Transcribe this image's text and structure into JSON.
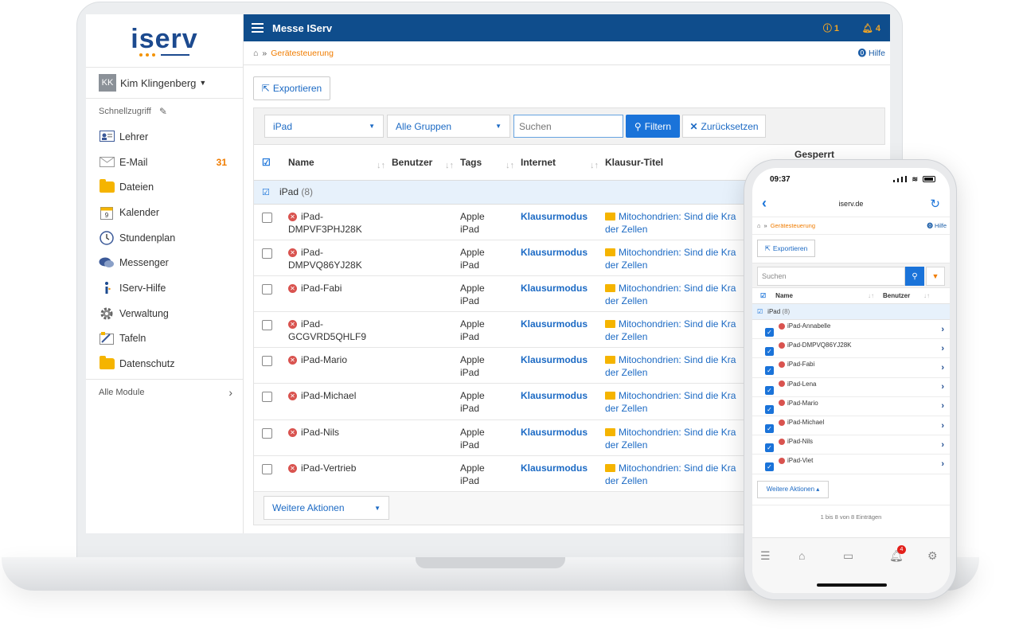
{
  "app": {
    "title": "Messe IServ",
    "logo_text": "iserv",
    "info_count": "1",
    "notif_count": "4"
  },
  "user": {
    "initials": "KK",
    "name": "Kim Klingenberg"
  },
  "sidebar": {
    "quick_label": "Schnellzugriff",
    "items": [
      {
        "label": "Lehrer",
        "icon": "teacher-icon"
      },
      {
        "label": "E-Mail",
        "icon": "mail-icon",
        "badge": "31"
      },
      {
        "label": "Dateien",
        "icon": "folder-icon"
      },
      {
        "label": "Kalender",
        "icon": "calendar-icon"
      },
      {
        "label": "Stundenplan",
        "icon": "clock-icon"
      },
      {
        "label": "Messenger",
        "icon": "chat-icon"
      },
      {
        "label": "IServ-Hilfe",
        "icon": "info-icon"
      },
      {
        "label": "Verwaltung",
        "icon": "gear-icon"
      },
      {
        "label": "Tafeln",
        "icon": "board-icon"
      },
      {
        "label": "Datenschutz",
        "icon": "folder-icon"
      }
    ],
    "all_modules": "Alle Module"
  },
  "breadcrumb": {
    "current": "Gerätesteuerung",
    "help": "Hilfe"
  },
  "toolbar": {
    "export_label": "Exportieren"
  },
  "filters": {
    "device_select": "iPad",
    "group_select": "Alle Gruppen",
    "search_placeholder": "Suchen",
    "filter_label": "Filtern",
    "reset_label": "Zurücksetzen"
  },
  "table": {
    "columns": [
      "Name",
      "Benutzer",
      "Tags",
      "Internet",
      "Klausur-Titel",
      "Gesperrt"
    ],
    "group": {
      "name": "iPad",
      "count": "(8)"
    },
    "rows": [
      {
        "name": "iPad-\nDMPVF3PHJ28K",
        "tags": "Apple\niPad",
        "internet": "Klausurmodus",
        "title": "Mitochondrien: Sind die Kra\nder Zellen"
      },
      {
        "name": "iPad-\nDMPVQ86YJ28K",
        "tags": "Apple\niPad",
        "internet": "Klausurmodus",
        "title": "Mitochondrien: Sind die Kra\nder Zellen"
      },
      {
        "name": "iPad-Fabi",
        "tags": "Apple\niPad",
        "internet": "Klausurmodus",
        "title": "Mitochondrien: Sind die Kra\nder Zellen"
      },
      {
        "name": "iPad-\nGCGVRD5QHLF9",
        "tags": "Apple\niPad",
        "internet": "Klausurmodus",
        "title": "Mitochondrien: Sind die Kra\nder Zellen"
      },
      {
        "name": "iPad-Mario",
        "tags": "Apple\niPad",
        "internet": "Klausurmodus",
        "title": "Mitochondrien: Sind die Kra\nder Zellen"
      },
      {
        "name": "iPad-Michael",
        "tags": "Apple\niPad",
        "internet": "Klausurmodus",
        "title": "Mitochondrien: Sind die Kra\nder Zellen"
      },
      {
        "name": "iPad-Nils",
        "tags": "Apple\niPad",
        "internet": "Klausurmodus",
        "title": "Mitochondrien: Sind die Kra\nder Zellen"
      },
      {
        "name": "iPad-Vertrieb",
        "tags": "Apple\niPad",
        "internet": "Klausurmodus",
        "title": "Mitochondrien: Sind die Kra\nder Zellen"
      }
    ],
    "bulk_label": "Weitere Aktionen"
  },
  "phone": {
    "time": "09:37",
    "url": "iserv.de",
    "breadcrumb": "Gerätesteuerung",
    "help": "Hilfe",
    "export_label": "Exportieren",
    "search_placeholder": "Suchen",
    "columns": [
      "Name",
      "Benutzer"
    ],
    "group": {
      "name": "iPad",
      "count": "(8)"
    },
    "rows": [
      "iPad-Annabelle",
      "iPad-DMPVQ86YJ28K",
      "iPad-Fabi",
      "iPad-Lena",
      "iPad-Mario",
      "iPad-Michael",
      "iPad-Nils",
      "iPad-Viet"
    ],
    "bulk_label": "Weitere Aktionen",
    "pagination_info": "1 bis 8 von 8 Einträgen",
    "tab_badge": "4"
  },
  "colors": {
    "brand_blue": "#0f4d8c",
    "accent_orange": "#f07c00",
    "link_blue": "#1c6ac4",
    "danger_red": "#d9534f"
  }
}
